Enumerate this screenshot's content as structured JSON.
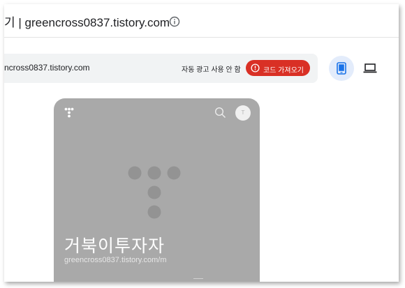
{
  "header": {
    "title": "기 | greencross0837.tistory.com"
  },
  "site_bar": {
    "url": "ncross0837.tistory.com",
    "auto_ads_status": "자동 광고 사용 안 함",
    "get_code_label": "코드 가져오기"
  },
  "preview": {
    "blog_name": "거북이투자자",
    "blog_url": "greencross0837.tistory.com/m",
    "avatar_letter": "T"
  },
  "colors": {
    "accent_red": "#d93025",
    "selected_device_bg": "#e3ecfb",
    "device_blue": "#1a73e8",
    "preview_bg": "#a9a9a9"
  },
  "icons": [
    "info-icon",
    "alert-icon",
    "mobile-device-icon",
    "desktop-device-icon",
    "tistory-logo-icon",
    "search-icon"
  ]
}
